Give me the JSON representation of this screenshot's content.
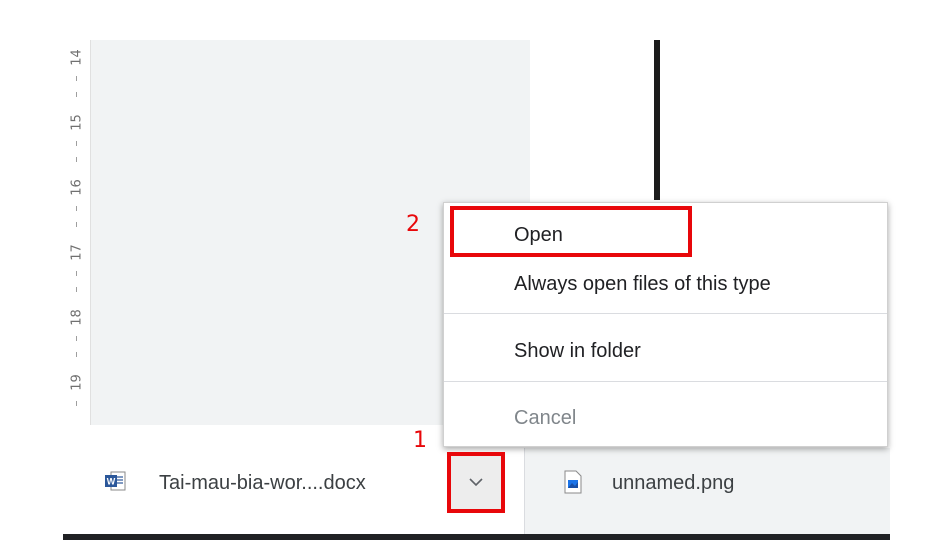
{
  "ruler": {
    "numbers": [
      "14",
      "15",
      "16",
      "17",
      "18",
      "19"
    ]
  },
  "downloads": {
    "items": [
      {
        "name": "Tai-mau-bia-wor....docx",
        "icon": "word-doc-icon"
      },
      {
        "name": "unnamed.png",
        "icon": "image-file-icon"
      }
    ],
    "menu_button_icon": "chevron-down-icon"
  },
  "context_menu": {
    "items": [
      "Open",
      "Always open files of this type",
      "Show in folder",
      "Cancel"
    ]
  },
  "annotations": {
    "step1": "1",
    "step2": "2",
    "color": "#e8070a"
  },
  "colors": {
    "word_blue": "#2b579a",
    "shelf_gray": "#f1f3f4"
  }
}
